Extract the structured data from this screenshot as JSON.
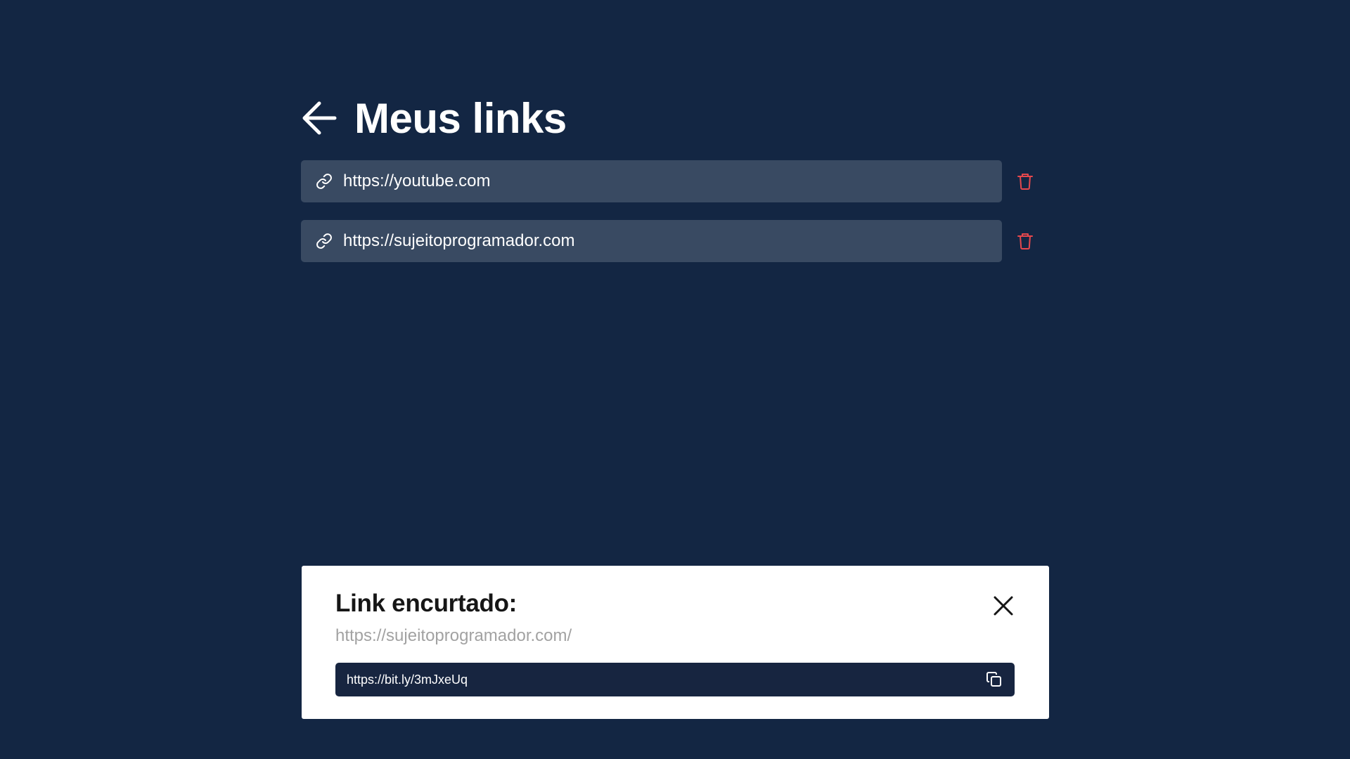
{
  "header": {
    "title": "Meus links",
    "back_icon": "arrow-left-icon"
  },
  "links": [
    {
      "url": "https://youtube.com",
      "icon": "link-icon",
      "action_icon": "trash-icon"
    },
    {
      "url": "https://sujeitoprogramador.com",
      "icon": "link-icon",
      "action_icon": "trash-icon"
    }
  ],
  "modal": {
    "title": "Link encurtado:",
    "original_url": "https://sujeitoprogramador.com/",
    "short_url": "https://bit.ly/3mJxeUq",
    "close_icon": "close-icon",
    "copy_icon": "copy-icon"
  },
  "colors": {
    "background": "#132643",
    "link_item": "#394a62",
    "delete": "#e5484d",
    "short_box": "#172540"
  }
}
